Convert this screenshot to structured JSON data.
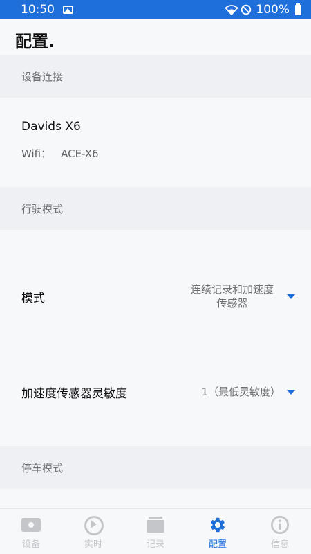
{
  "status_bar": {
    "time": "10:50",
    "battery": "100%",
    "icons": [
      "image-icon",
      "wifi-icon",
      "do-not-disturb-icon",
      "battery-icon"
    ]
  },
  "page": {
    "title": "配置."
  },
  "sections": {
    "device": {
      "header": "设备连接",
      "device_name": "Davids X6",
      "wifi_label": "Wifi：",
      "wifi_value": "ACE-X6"
    },
    "driving": {
      "header": "行驶模式",
      "mode_label": "模式",
      "mode_value_line1": "连续记录和加速度",
      "mode_value_line2": "传感器",
      "sensitivity_label": "加速度传感器灵敏度",
      "sensitivity_value": "1（最低灵敏度）"
    },
    "parking": {
      "header": "停车模式"
    }
  },
  "bottom_nav": {
    "items": [
      {
        "label": "设备",
        "icon": "device-icon"
      },
      {
        "label": "实时",
        "icon": "play-circle-icon"
      },
      {
        "label": "记录",
        "icon": "folder-icon"
      },
      {
        "label": "配置",
        "icon": "gear-icon",
        "active": true
      },
      {
        "label": "信息",
        "icon": "info-icon"
      }
    ]
  },
  "colors": {
    "accent": "#1e6fd9",
    "inactive": "#c4c6ca",
    "section_bg": "#eef0f3"
  }
}
